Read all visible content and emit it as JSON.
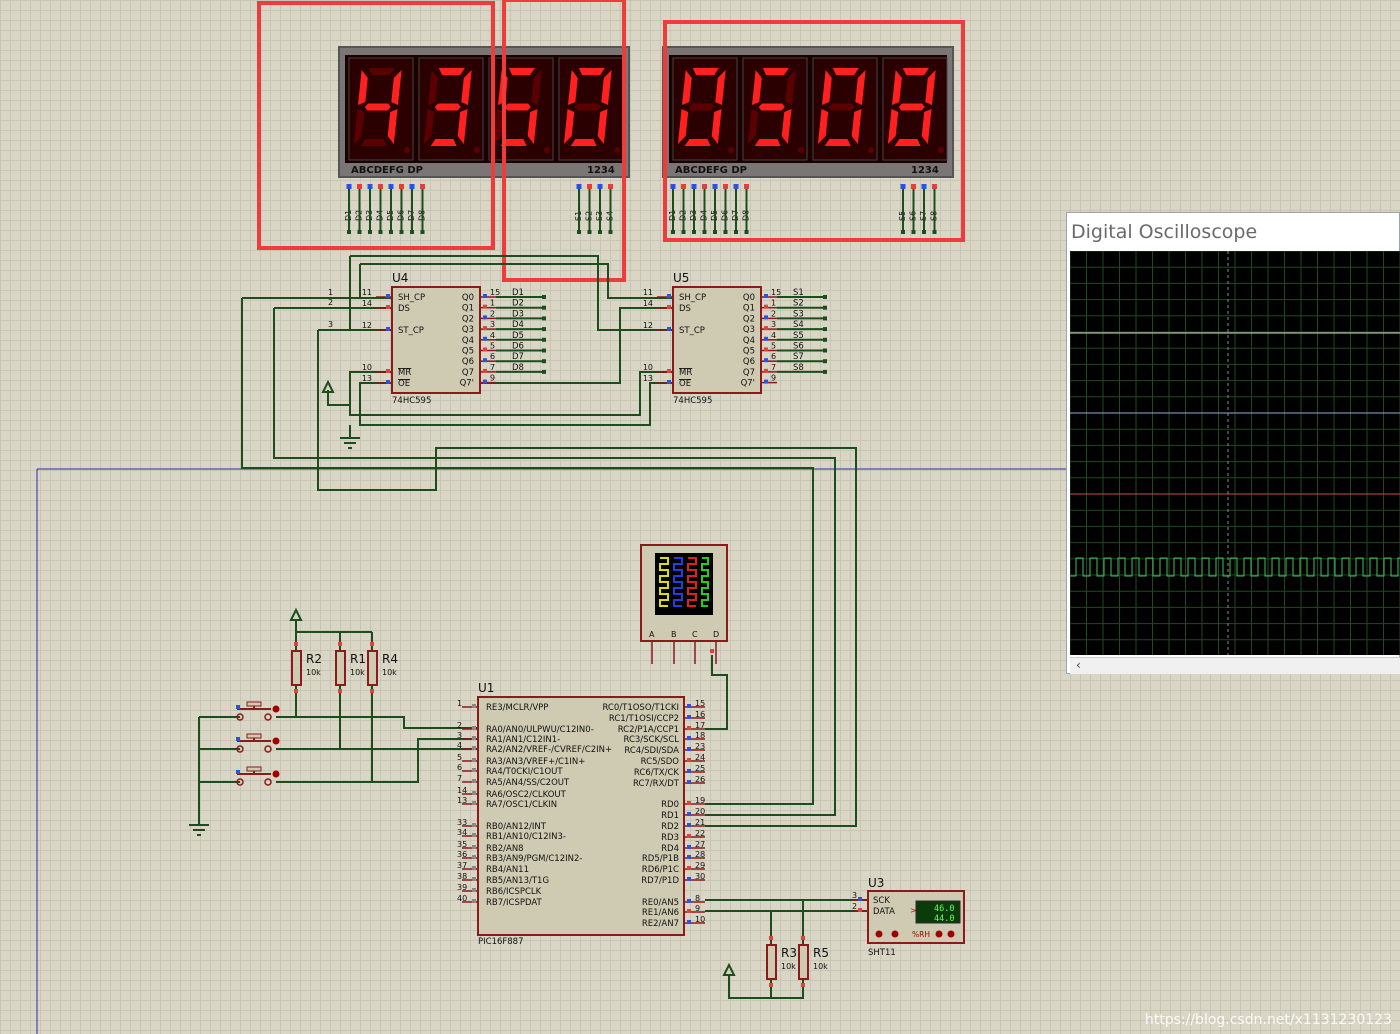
{
  "display_left": {
    "digits": [
      "4",
      "3",
      "5",
      "0"
    ],
    "segment_label": "ABCDEFG DP",
    "common_label": "1234",
    "pins": [
      "D1",
      "D2",
      "D3",
      "D4",
      "D5",
      "D6",
      "D7",
      "D8",
      "S1",
      "S2",
      "S3",
      "S4"
    ]
  },
  "display_right": {
    "digits": [
      "0",
      "5",
      "0",
      "8"
    ],
    "segment_label": "ABCDEFG DP",
    "common_label": "1234",
    "pins": [
      "D1",
      "D2",
      "D3",
      "D4",
      "D5",
      "D6",
      "D7",
      "D8",
      "S5",
      "S6",
      "S7",
      "S8"
    ]
  },
  "u4": {
    "ref": "U4",
    "part": "74HC595",
    "left_pins": [
      [
        "11",
        "SH_CP"
      ],
      [
        "14",
        "DS"
      ],
      [
        "12",
        "ST_CP"
      ],
      [
        "10",
        "MR"
      ],
      [
        "13",
        "OE"
      ]
    ],
    "right_pins": [
      [
        "15",
        "Q0"
      ],
      [
        "1",
        "Q1"
      ],
      [
        "2",
        "Q2"
      ],
      [
        "3",
        "Q3"
      ],
      [
        "4",
        "Q4"
      ],
      [
        "5",
        "Q5"
      ],
      [
        "6",
        "Q6"
      ],
      [
        "7",
        "Q7"
      ],
      [
        "9",
        "Q7'"
      ]
    ],
    "net_labels": [
      "D1",
      "D2",
      "D3",
      "D4",
      "D5",
      "D6",
      "D7",
      "D8"
    ]
  },
  "u5": {
    "ref": "U5",
    "part": "74HC595",
    "left_pins": [
      [
        "11",
        "SH_CP"
      ],
      [
        "14",
        "DS"
      ],
      [
        "12",
        "ST_CP"
      ],
      [
        "10",
        "MR"
      ],
      [
        "13",
        "OE"
      ]
    ],
    "right_pins": [
      [
        "15",
        "Q0"
      ],
      [
        "1",
        "Q1"
      ],
      [
        "2",
        "Q2"
      ],
      [
        "3",
        "Q3"
      ],
      [
        "4",
        "Q4"
      ],
      [
        "5",
        "Q5"
      ],
      [
        "6",
        "Q6"
      ],
      [
        "7",
        "Q7"
      ],
      [
        "9",
        "Q7'"
      ]
    ],
    "net_labels": [
      "S1",
      "S2",
      "S3",
      "S4",
      "S5",
      "S6",
      "S7",
      "S8"
    ]
  },
  "bus_numbers": [
    "1",
    "2",
    "3"
  ],
  "resistors_top": [
    {
      "ref": "R2",
      "value": "10k"
    },
    {
      "ref": "R1",
      "value": "10k"
    },
    {
      "ref": "R4",
      "value": "10k"
    }
  ],
  "resistors_bottom": [
    {
      "ref": "R3",
      "value": "10k"
    },
    {
      "ref": "R5",
      "value": "10k"
    }
  ],
  "scope_channels": [
    "A",
    "B",
    "C",
    "D"
  ],
  "u1": {
    "ref": "U1",
    "part": "PIC16F887",
    "left_pins": [
      [
        "1",
        "RE3/MCLR/VPP"
      ],
      [
        "2",
        "RA0/AN0/ULPWU/C12IN0-"
      ],
      [
        "3",
        "RA1/AN1/C12IN1-"
      ],
      [
        "4",
        "RA2/AN2/VREF-/CVREF/C2IN+"
      ],
      [
        "5",
        "RA3/AN3/VREF+/C1IN+"
      ],
      [
        "6",
        "RA4/T0CKI/C1OUT"
      ],
      [
        "7",
        "RA5/AN4/SS/C2OUT"
      ],
      [
        "14",
        "RA6/OSC2/CLKOUT"
      ],
      [
        "13",
        "RA7/OSC1/CLKIN"
      ],
      [
        "33",
        "RB0/AN12/INT"
      ],
      [
        "34",
        "RB1/AN10/C12IN3-"
      ],
      [
        "35",
        "RB2/AN8"
      ],
      [
        "36",
        "RB3/AN9/PGM/C12IN2-"
      ],
      [
        "37",
        "RB4/AN11"
      ],
      [
        "38",
        "RB5/AN13/T1G"
      ],
      [
        "39",
        "RB6/ICSPCLK"
      ],
      [
        "40",
        "RB7/ICSPDAT"
      ]
    ],
    "right_pins": [
      [
        "15",
        "RC0/T1OSO/T1CKI"
      ],
      [
        "16",
        "RC1/T1OSI/CCP2"
      ],
      [
        "17",
        "RC2/P1A/CCP1"
      ],
      [
        "18",
        "RC3/SCK/SCL"
      ],
      [
        "23",
        "RC4/SDI/SDA"
      ],
      [
        "24",
        "RC5/SDO"
      ],
      [
        "25",
        "RC6/TX/CK"
      ],
      [
        "26",
        "RC7/RX/DT"
      ],
      [
        "19",
        "RD0"
      ],
      [
        "20",
        "RD1"
      ],
      [
        "21",
        "RD2"
      ],
      [
        "22",
        "RD3"
      ],
      [
        "27",
        "RD4"
      ],
      [
        "28",
        "RD5/P1B"
      ],
      [
        "29",
        "RD6/P1C"
      ],
      [
        "30",
        "RD7/P1D"
      ],
      [
        "8",
        "RE0/AN5"
      ],
      [
        "9",
        "RE1/AN6"
      ],
      [
        "10",
        "RE2/AN7"
      ]
    ]
  },
  "u3": {
    "ref": "U3",
    "part": "SHT11",
    "pins": [
      [
        "3",
        "SCK"
      ],
      [
        "2",
        "DATA"
      ]
    ],
    "temperature": "46.0",
    "humidity": "44.0",
    "rh_label": "%RH"
  },
  "oscilloscope": {
    "title": "Digital Oscilloscope",
    "trace_colors": [
      "#e0e0c0",
      "#8fb0d0",
      "#c05050",
      "#40c060"
    ],
    "scroll_arrow": "‹"
  },
  "watermark": "https://blog.csdn.net/x1131230123",
  "colors": {
    "wire": "#1c4d1c",
    "annotation": "#ef3b3b",
    "segment_on": "#ff2020",
    "segment_off": "#5a0000",
    "chip_border": "#8b1a1a"
  }
}
